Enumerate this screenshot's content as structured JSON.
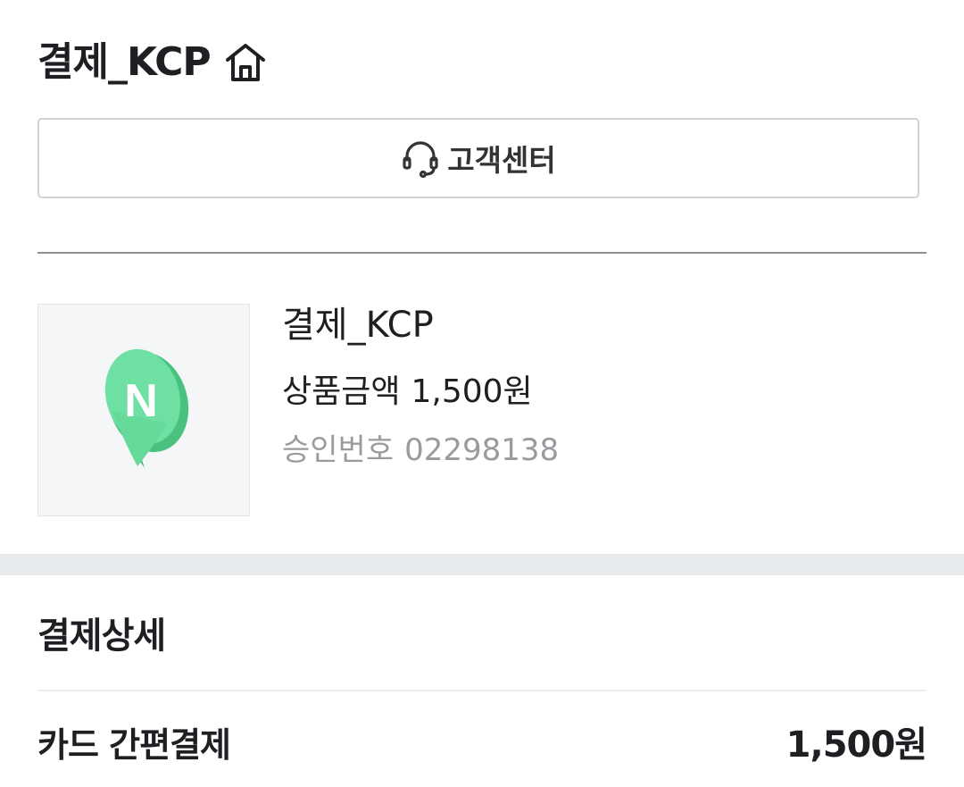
{
  "header": {
    "title": "결제_KCP",
    "home_icon": "home-icon"
  },
  "support": {
    "label": "고객센터",
    "icon": "headset-icon"
  },
  "product": {
    "icon": "naver-map-pin-icon",
    "brand_color": "#03c75a",
    "logo_letter": "N",
    "name": "결제_KCP",
    "amount_label": "상품금액",
    "amount_value": "1,500원",
    "approval_label": "승인번호",
    "approval_value": "02298138"
  },
  "detail": {
    "title": "결제상세",
    "method": "카드 간편결제",
    "amount": "1,500원"
  },
  "colors": {
    "text": "#1e1e23",
    "muted": "#999b9f",
    "border": "#d2d4d8",
    "band": "#e8ebee"
  }
}
